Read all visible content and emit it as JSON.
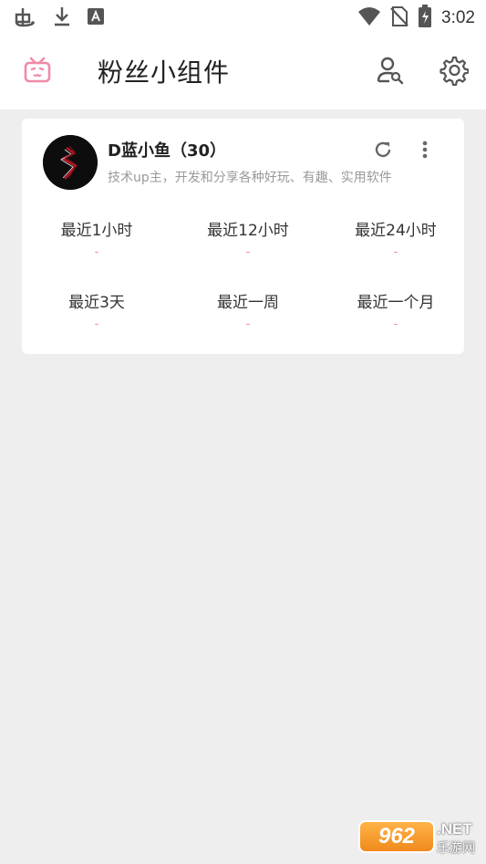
{
  "status_bar": {
    "time": "3:02",
    "icons": [
      "bug-icon",
      "download-icon",
      "font-icon",
      "wifi-icon",
      "no-sim-icon",
      "battery-icon"
    ]
  },
  "app_bar": {
    "title": "粉丝小组件",
    "logo_color": "#f08aa8"
  },
  "card": {
    "name": "D蓝小鱼（30）",
    "description": "技术up主，开发和分享各种好玩、有趣、实用软件",
    "stats": [
      {
        "label": "最近1小时",
        "value": "-"
      },
      {
        "label": "最近12小时",
        "value": "-"
      },
      {
        "label": "最近24小时",
        "value": "-"
      },
      {
        "label": "最近3天",
        "value": "-"
      },
      {
        "label": "最近一周",
        "value": "-"
      },
      {
        "label": "最近一个月",
        "value": "-"
      }
    ]
  },
  "watermark": {
    "badge": "962",
    "net": ".NET",
    "text": "乐游网"
  },
  "colors": {
    "accent": "#f08aa8",
    "background": "#eeeeee",
    "card": "#ffffff"
  }
}
